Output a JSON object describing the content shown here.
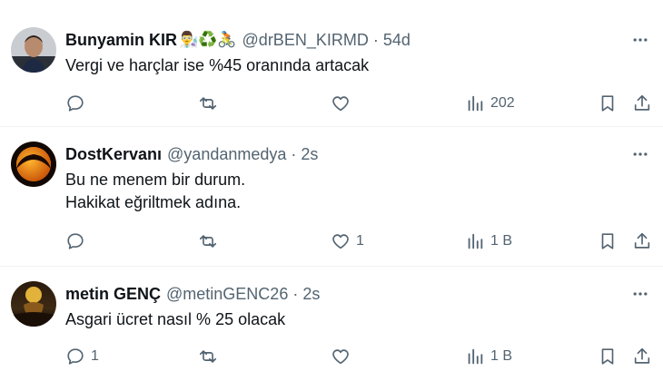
{
  "tweets": [
    {
      "name": "Bunyamin KIR",
      "name_emojis": "👨‍🔬♻️🚴",
      "handle": "@drBEN_KIRMD",
      "separator": "·",
      "time": "54d",
      "text_lines": [
        "Vergi ve harçlar ise %45 oranında artacak"
      ],
      "reply_count": "",
      "retweet_count": "",
      "like_count": "",
      "views_count": "202"
    },
    {
      "name": "DostKervanı",
      "name_emojis": "",
      "handle": "@yandanmedya",
      "separator": "·",
      "time": "2s",
      "text_lines": [
        "Bu ne menem bir durum.",
        "Hakikat eğriltmek adına."
      ],
      "reply_count": "",
      "retweet_count": "",
      "like_count": "1",
      "views_count": "1 B"
    },
    {
      "name": "metin GENÇ",
      "name_emojis": "",
      "handle": "@metinGENC26",
      "separator": "·",
      "time": "2s",
      "text_lines": [
        "Asgari ücret nasıl % 25 olacak"
      ],
      "reply_count": "1",
      "retweet_count": "",
      "like_count": "",
      "views_count": "1 B"
    }
  ],
  "colors": {
    "text_primary": "#0f1419",
    "text_secondary": "#536471",
    "divider": "#eff3f4"
  },
  "icons": {
    "reply": "reply-icon",
    "retweet": "retweet-icon",
    "like": "heart-icon",
    "views": "views-icon",
    "bookmark": "bookmark-icon",
    "share": "share-icon",
    "more": "more-icon"
  }
}
